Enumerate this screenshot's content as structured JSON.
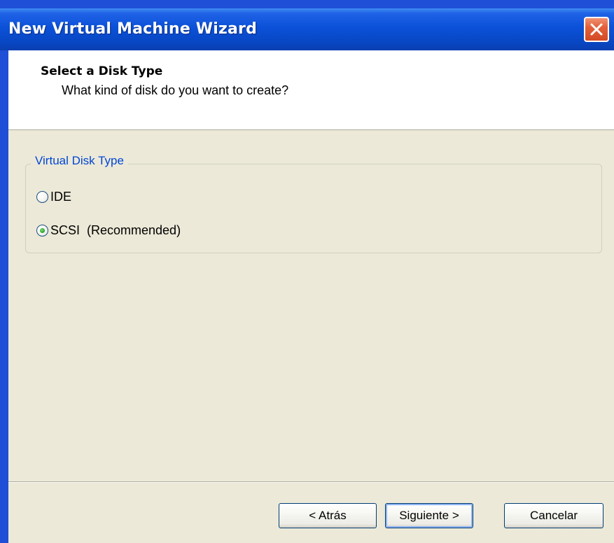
{
  "window": {
    "title": "New Virtual Machine Wizard"
  },
  "header": {
    "title": "Select a Disk Type",
    "subtitle": "What kind of disk do you want to create?"
  },
  "disk_type_group": {
    "label": "Virtual Disk Type",
    "options": [
      {
        "label": "IDE",
        "checked": false
      },
      {
        "label": "SCSI  (Recommended)",
        "checked": true
      }
    ]
  },
  "buttons": {
    "back": "< Atrás",
    "next": "Siguiente >",
    "cancel": "Cancelar"
  },
  "colors": {
    "titlebar": "#0b51d8",
    "client_background": "#ece9d8",
    "group_label": "#0046d5",
    "close_button": "#e3603a"
  }
}
